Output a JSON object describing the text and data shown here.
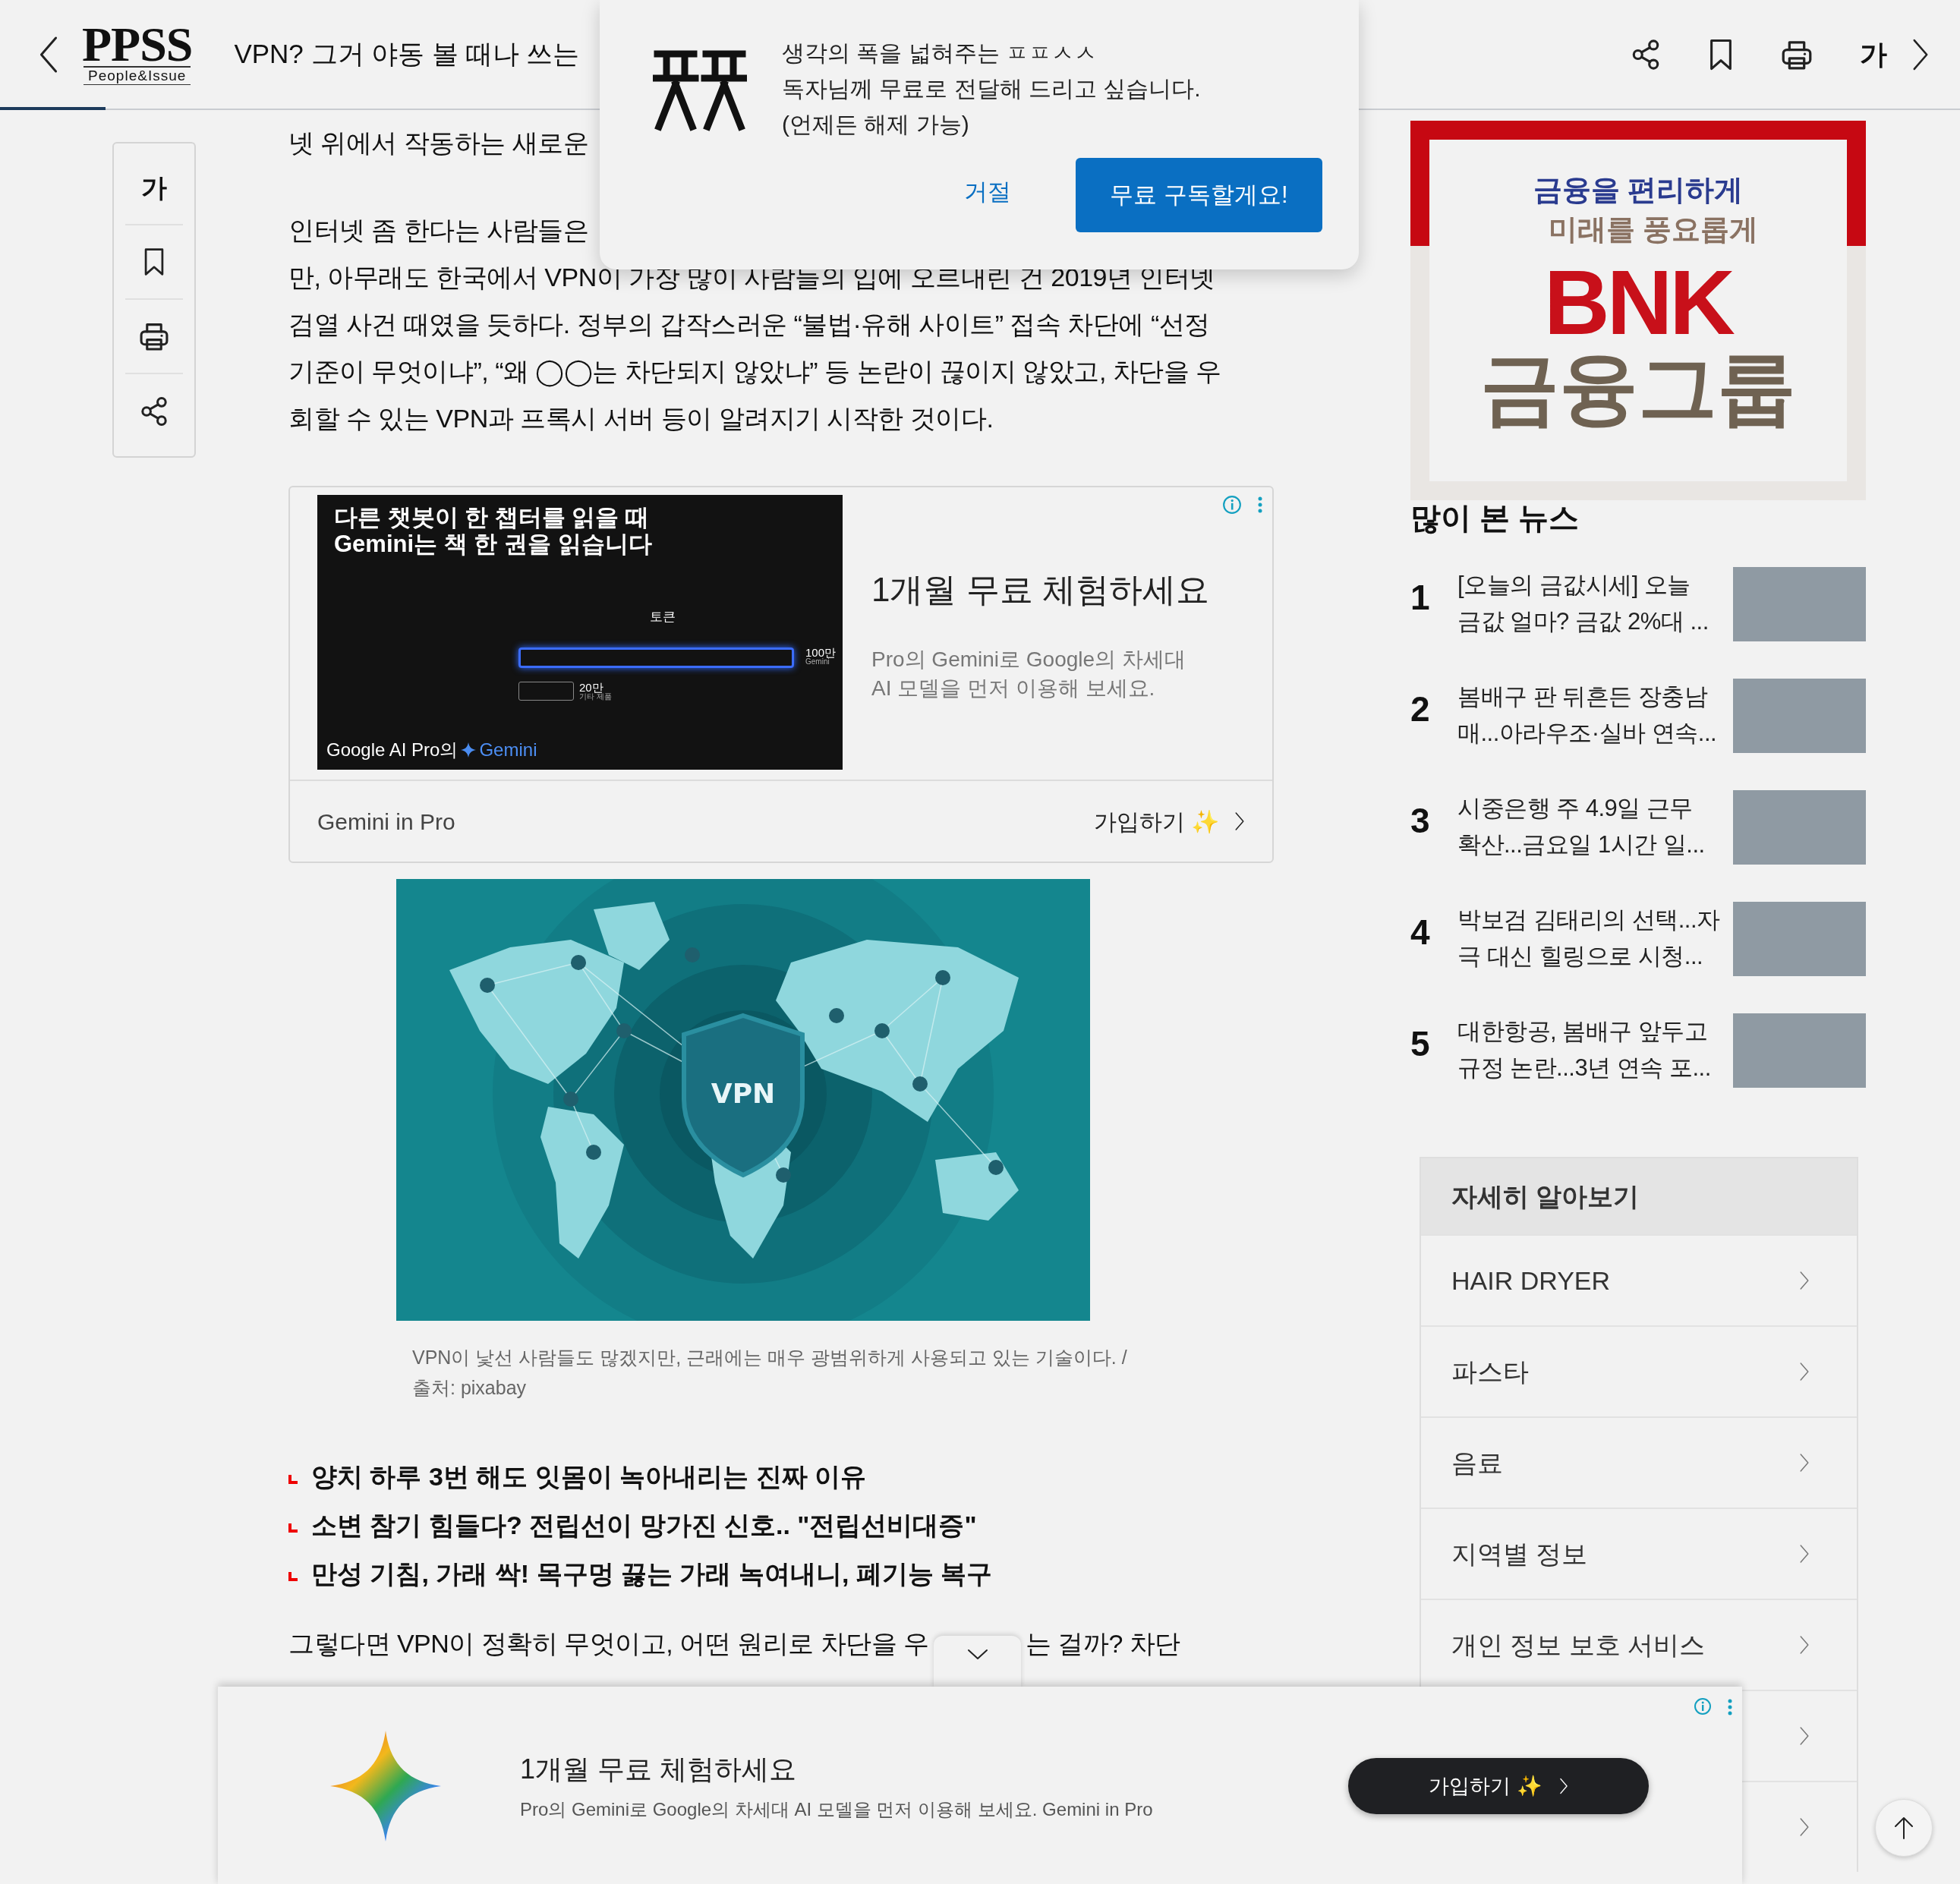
{
  "header": {
    "logo": "PPSS",
    "tagline": "People&Issue",
    "title": "VPN? 그거 야동 볼 때나 쓰는",
    "font_button": "가",
    "progress": {
      "level": 0.054
    }
  },
  "popup": {
    "lines": [
      "생각의 폭을 넓혀주는 ㅍㅍㅅㅅ",
      "독자님께 무료로 전달해 드리고 싶습니다.",
      "(언제든 해제 가능)"
    ],
    "decline": "거절",
    "accept": "무료 구독할게요!"
  },
  "side_tools": {
    "font_button": "가"
  },
  "article": {
    "intro": [
      {
        "lines": [
          "넷 위에서 작동하는 새로운"
        ]
      },
      {
        "lines": [
          "인터넷 좀 한다는 사람들은",
          "만, 아무래도 한국에서 VPN이 가장 많이 사람들의 입에 오르내린 건 2019년 인터넷",
          "검열 사건 때였을 듯하다. 정부의 갑작스러운 “불법·유해 사이트” 접속 차단에 “선정",
          "기준이 무엇이냐”, “왜 ◯◯는 차단되지 않았냐” 등 논란이 끊이지 않았고, 차단을 우",
          "회할 수 있는 VPN과 프록시 서버 등이 알려지기 시작한 것이다."
        ]
      }
    ],
    "ad": {
      "banner_lines": [
        "다른 챗봇이 한 챕터를 읽을 때",
        "Gemini는 책 한 권을 읽습니다"
      ],
      "chart_label": "토큰",
      "bar_labels": [
        {
          "value": "100만",
          "caption": "Gemini"
        },
        {
          "value": "20만",
          "caption": "기타 제품"
        }
      ],
      "brand": "Google AI Pro의",
      "product": "Gemini",
      "title": "1개월 무료 체험하세요",
      "body_lines": [
        "Pro의 Gemini로 Google의 차세대",
        "AI 모델을 먼저 이용해 보세요."
      ],
      "advertiser": "Gemini in Pro",
      "cta": "가입하기 ✨"
    },
    "figure": {
      "image_label": "VPN",
      "caption_lines": [
        "VPN이 낯선 사람들도 많겠지만, 근래에는 매우 광범위하게 사용되고 있는 기술이다. /",
        "출처: pixabay"
      ]
    },
    "related": [
      "양치 하루 3번 해도 잇몸이 녹아내리는 진짜 이유",
      "소변 참기 힘들다? 전립선이 망가진 신호.. \"전립선비대증\"",
      "만성 기침, 가래 싹! 목구멍 끓는 가래 녹여내니, 폐기능 복구"
    ],
    "outro": [
      "그렇다면 VPN이 정확히 무엇이고, 어떤 원리로 차단을 우",
      "는 걸까? 차단"
    ]
  },
  "sidebar": {
    "bnk_ad": {
      "slogan_lines": [
        "금융을 **편리**하게",
        "미래를 **풍요**롭게"
      ],
      "brand": "BNK",
      "group": "금융그룹"
    },
    "most_read": {
      "title": "많이 본 뉴스",
      "items": [
        {
          "rank": "1",
          "title_lines": [
            "[오늘의 금값시세] 오늘",
            "금값 얼마? 금값 2%대 ..."
          ]
        },
        {
          "rank": "2",
          "title_lines": [
            "봄배구 판 뒤흔든 장충남",
            "매...아라우조·실바 연속..."
          ]
        },
        {
          "rank": "3",
          "title_lines": [
            "시중은행 주 4.9일 근무",
            "확산...금요일 1시간 일..."
          ]
        },
        {
          "rank": "4",
          "title_lines": [
            "박보검 김태리의 선택...자",
            "극 대신 힐링으로 시청..."
          ]
        },
        {
          "rank": "5",
          "title_lines": [
            "대한항공, 봄배구 앞두고",
            "규정 논란...3년 연속 포..."
          ]
        }
      ]
    },
    "learn_more": {
      "title": "자세히 알아보기",
      "items": [
        {
          "label": "HAIR DRYER",
          "covered": false
        },
        {
          "label": "파스타",
          "covered": false
        },
        {
          "label": "음료",
          "covered": false
        },
        {
          "label": "지역별 정보",
          "covered": false
        },
        {
          "label": "개인 정보 보호 서비스",
          "covered": false
        },
        {
          "covered": true
        },
        {
          "covered": true
        }
      ]
    }
  },
  "bottom_ad": {
    "title": "1개월 무료 체험하세요",
    "body": "Pro의 Gemini로 Google의 차세대 AI 모델을 먼저 이용해 보세요. Gemini in Pro",
    "cta": "가입하기 ✨"
  }
}
